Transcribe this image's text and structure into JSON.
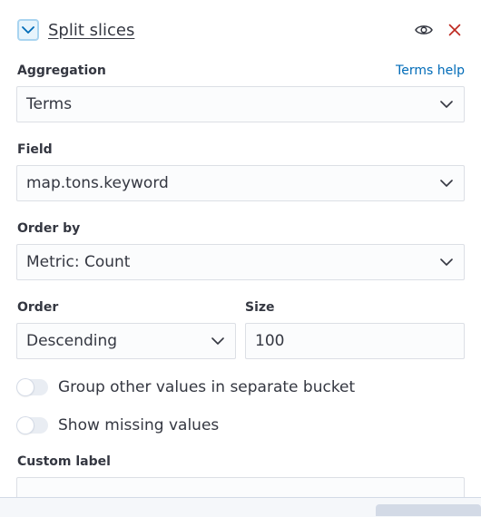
{
  "header": {
    "title": "Split slices",
    "icons": [
      "chevron-down-icon",
      "eye-icon",
      "close-icon"
    ],
    "accent_color": "#a9d4f0",
    "close_color": "#bd271e"
  },
  "aggregation": {
    "label": "Aggregation",
    "help_link": "Terms help",
    "value": "Terms"
  },
  "field": {
    "label": "Field",
    "value": "map.tons.keyword"
  },
  "order_by": {
    "label": "Order by",
    "value": "Metric: Count"
  },
  "order": {
    "label": "Order",
    "value": "Descending"
  },
  "size": {
    "label": "Size",
    "value": "100"
  },
  "toggles": {
    "group_other": {
      "label": "Group other values in separate bucket",
      "checked": false
    },
    "show_missing": {
      "label": "Show missing values",
      "checked": false
    }
  },
  "custom_label": {
    "label": "Custom label",
    "value": ""
  },
  "colors": {
    "link": "#006bb8",
    "text": "#343741",
    "border": "#dcdfe5"
  }
}
